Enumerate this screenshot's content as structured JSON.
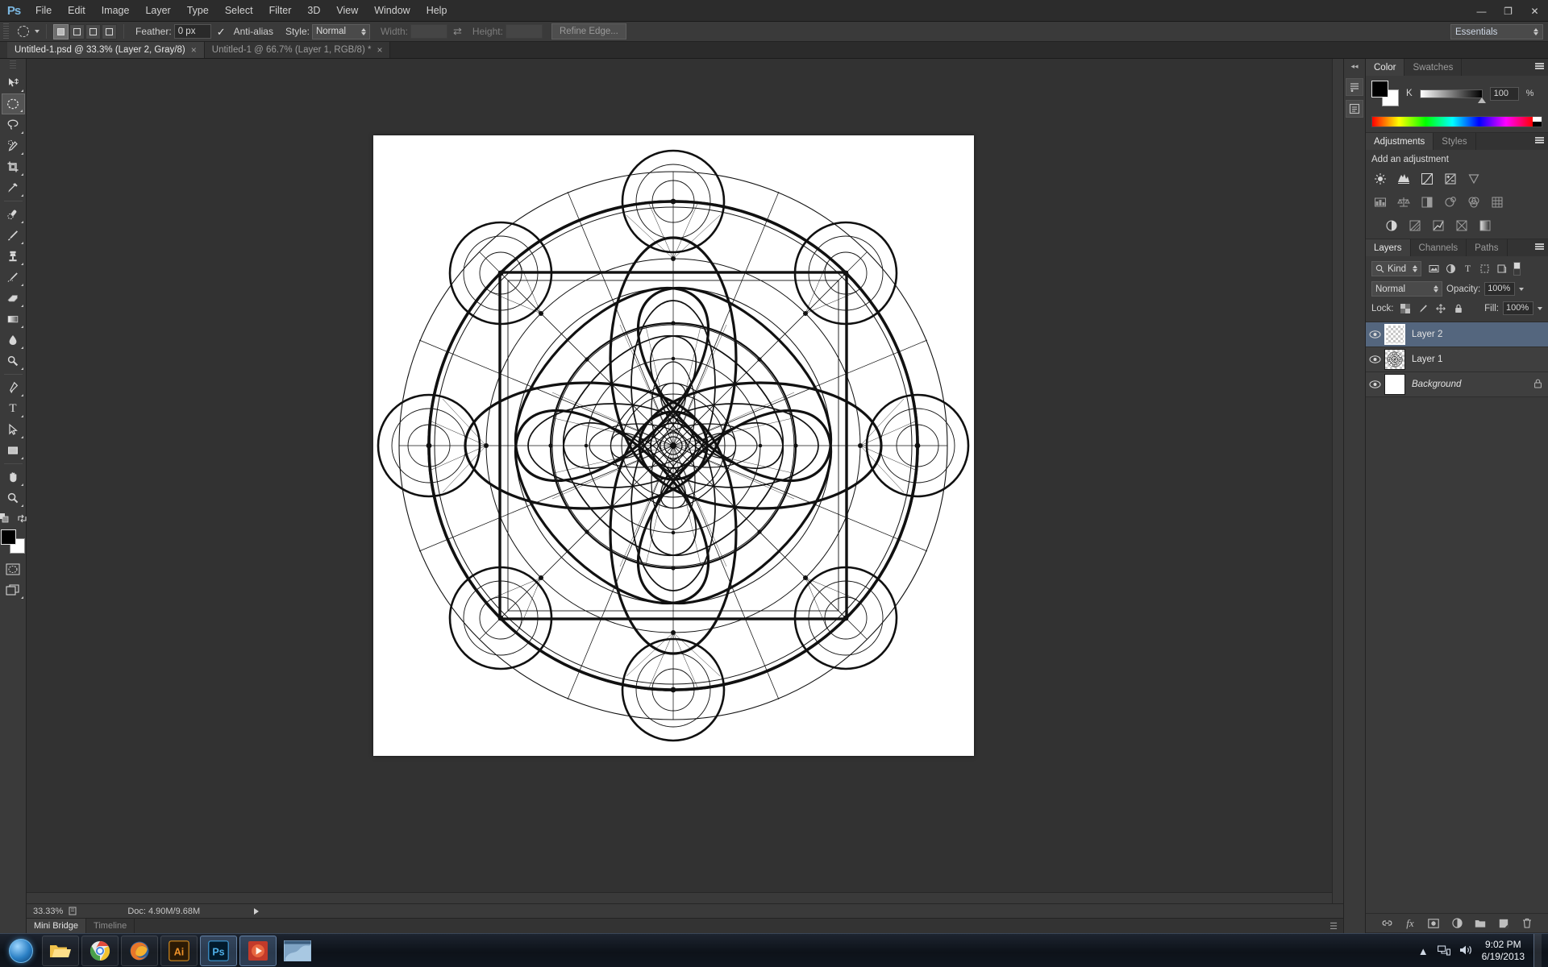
{
  "app": {
    "name": "Adobe Photoshop",
    "logo_text": "Ps",
    "workspace": "Essentials"
  },
  "menubar": {
    "items": [
      {
        "label": "File"
      },
      {
        "label": "Edit"
      },
      {
        "label": "Image"
      },
      {
        "label": "Layer"
      },
      {
        "label": "Type"
      },
      {
        "label": "Select"
      },
      {
        "label": "Filter"
      },
      {
        "label": "3D"
      },
      {
        "label": "View"
      },
      {
        "label": "Window"
      },
      {
        "label": "Help"
      }
    ],
    "window_buttons": {
      "minimize": "—",
      "restore": "❐",
      "close": "✕"
    }
  },
  "options_bar": {
    "tool": "elliptical-marquee",
    "selection_modes": [
      "new-selection",
      "add-to-selection",
      "subtract-from-selection",
      "intersect-with-selection"
    ],
    "active_selection_mode": 0,
    "feather_label": "Feather:",
    "feather_value": "0 px",
    "antialias_label": "Anti-alias",
    "antialias_checked": true,
    "style_label": "Style:",
    "style_value": "Normal",
    "width_label": "Width:",
    "width_value": "",
    "height_label": "Height:",
    "height_value": "",
    "refine_edge_label": "Refine Edge..."
  },
  "document_tabs": [
    {
      "title": "Untitled-1.psd @ 33.3% (Layer 2, Gray/8)",
      "active": true,
      "close": "×"
    },
    {
      "title": "Untitled-1 @ 66.7% (Layer 1, RGB/8) *",
      "active": false,
      "close": "×"
    }
  ],
  "toolbar": {
    "tools": [
      {
        "name": "move-tool",
        "active": false
      },
      {
        "name": "elliptical-marquee-tool",
        "active": true
      },
      {
        "name": "lasso-tool",
        "active": false
      },
      {
        "name": "quick-selection-tool",
        "active": false
      },
      {
        "name": "crop-tool",
        "active": false
      },
      {
        "name": "eyedropper-tool",
        "active": false
      },
      {
        "name": "spot-healing-brush-tool",
        "active": false
      },
      {
        "name": "brush-tool",
        "active": false
      },
      {
        "name": "clone-stamp-tool",
        "active": false
      },
      {
        "name": "history-brush-tool",
        "active": false
      },
      {
        "name": "eraser-tool",
        "active": false
      },
      {
        "name": "gradient-tool",
        "active": false
      },
      {
        "name": "blur-tool",
        "active": false
      },
      {
        "name": "dodge-tool",
        "active": false
      },
      {
        "name": "pen-tool",
        "active": false
      },
      {
        "name": "horizontal-type-tool",
        "active": false
      },
      {
        "name": "path-selection-tool",
        "active": false
      },
      {
        "name": "rectangle-tool",
        "active": false
      },
      {
        "name": "hand-tool",
        "active": false
      },
      {
        "name": "zoom-tool",
        "active": false
      }
    ],
    "type_tool_glyph": "T",
    "foreground_color": "#000000",
    "background_color": "#ffffff"
  },
  "canvas": {
    "artwork_title": "geometric-mandala-line-art",
    "background_color": "#ffffff",
    "workspace_color": "#323232"
  },
  "status_bar": {
    "zoom": "33.33%",
    "doc_info": "Doc: 4.90M/9.68M"
  },
  "bottom_tabs": [
    {
      "label": "Mini Bridge",
      "active": true
    },
    {
      "label": "Timeline",
      "active": false
    }
  ],
  "color_panel": {
    "tabs": [
      {
        "label": "Color",
        "active": true
      },
      {
        "label": "Swatches",
        "active": false
      }
    ],
    "channel_label": "K",
    "channel_value": "100",
    "percent_symbol": "%",
    "foreground": "#000000",
    "background": "#ffffff"
  },
  "adjustments_panel": {
    "tabs": [
      {
        "label": "Adjustments",
        "active": true
      },
      {
        "label": "Styles",
        "active": false
      }
    ],
    "heading": "Add an adjustment",
    "icons": [
      "brightness-contrast-icon",
      "levels-icon",
      "curves-icon",
      "exposure-icon",
      "vibrance-icon",
      "hue-saturation-icon",
      "color-balance-icon",
      "black-white-icon",
      "photo-filter-icon",
      "channel-mixer-icon",
      "color-lookup-icon",
      "invert-icon",
      "posterize-icon",
      "threshold-icon",
      "selective-color-icon",
      "gradient-map-icon"
    ]
  },
  "layers_panel": {
    "tabs": [
      {
        "label": "Layers",
        "active": true
      },
      {
        "label": "Channels",
        "active": false
      },
      {
        "label": "Paths",
        "active": false
      }
    ],
    "filter_label": "Kind",
    "filter_icons": [
      "pixel-filter-icon",
      "adjustment-filter-icon",
      "type-filter-icon",
      "shape-filter-icon",
      "smart-object-filter-icon"
    ],
    "blend_mode": "Normal",
    "opacity_label": "Opacity:",
    "opacity_value": "100%",
    "lock_label": "Lock:",
    "lock_icons": [
      "lock-transparent-pixels-icon",
      "lock-image-pixels-icon",
      "lock-position-icon",
      "lock-all-icon"
    ],
    "fill_label": "Fill:",
    "fill_value": "100%",
    "layers": [
      {
        "name": "Layer 2",
        "visible": true,
        "selected": true,
        "thumbnail": "transparent",
        "locked": false,
        "italic": false
      },
      {
        "name": "Layer 1",
        "visible": true,
        "selected": false,
        "thumbnail": "artwork",
        "locked": false,
        "italic": false
      },
      {
        "name": "Background",
        "visible": true,
        "selected": false,
        "thumbnail": "white",
        "locked": true,
        "italic": true
      }
    ],
    "footer_icons": [
      "link-layers-icon",
      "layer-style-icon",
      "layer-mask-icon",
      "new-adjustment-layer-icon",
      "new-group-icon",
      "new-layer-icon",
      "delete-layer-icon"
    ],
    "layer_style_glyph": "fx"
  },
  "dock_strip": {
    "icons": [
      "collapse-panels-icon",
      "history-panel-icon",
      "properties-panel-icon"
    ]
  },
  "taskbar": {
    "start_button": "start-orb",
    "apps": [
      {
        "name": "windows-explorer",
        "label": "Explorer"
      },
      {
        "name": "google-chrome",
        "label": "Chrome"
      },
      {
        "name": "mozilla-firefox",
        "label": "Firefox"
      },
      {
        "name": "adobe-illustrator",
        "label": "Ai"
      },
      {
        "name": "adobe-photoshop",
        "label": "Ps"
      },
      {
        "name": "media-player",
        "label": "Media"
      },
      {
        "name": "window-thumbnail",
        "label": ""
      }
    ],
    "tray": {
      "show_hidden": "▲",
      "network_icon": "network-icon",
      "volume_icon": "volume-icon",
      "time": "9:02 PM",
      "date": "6/19/2013"
    }
  }
}
